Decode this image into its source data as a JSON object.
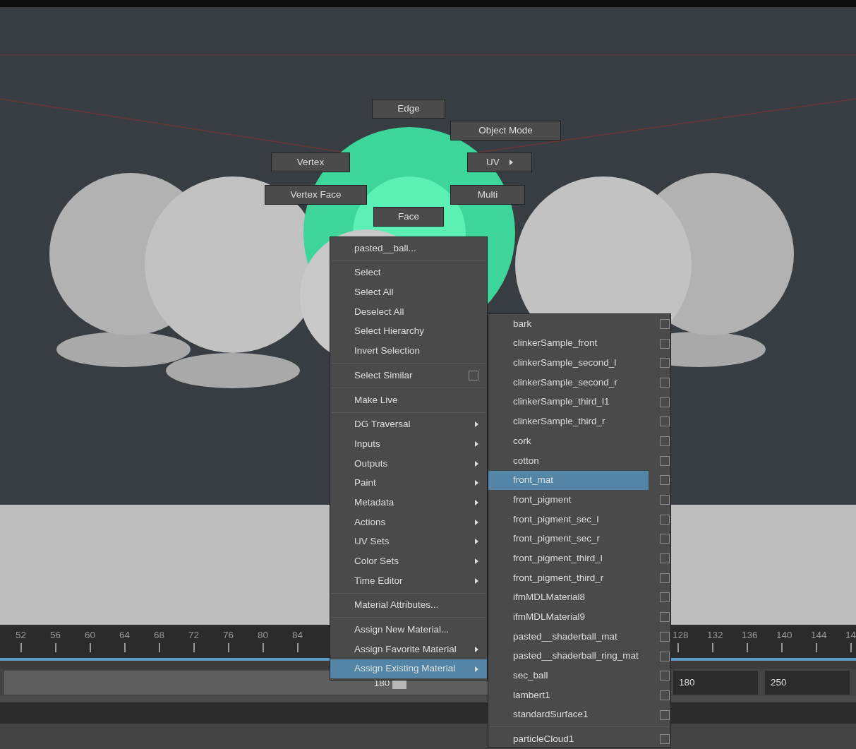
{
  "marking_menu": [
    {
      "label": "Edge",
      "submenu": false
    },
    {
      "label": "Object Mode",
      "submenu": false
    },
    {
      "label": "Vertex",
      "submenu": false
    },
    {
      "label": "UV",
      "submenu": true
    },
    {
      "label": "Vertex Face",
      "submenu": false
    },
    {
      "label": "Multi",
      "submenu": false
    },
    {
      "label": "Face",
      "submenu": false
    }
  ],
  "context_menu": {
    "title": "pasted__ball...",
    "groups": [
      {
        "items": [
          {
            "label": "Select",
            "submenu": false,
            "option_box": false,
            "selected": false
          },
          {
            "label": "Select All",
            "submenu": false,
            "option_box": false,
            "selected": false
          },
          {
            "label": "Deselect All",
            "submenu": false,
            "option_box": false,
            "selected": false
          },
          {
            "label": "Select Hierarchy",
            "submenu": false,
            "option_box": false,
            "selected": false
          },
          {
            "label": "Invert Selection",
            "submenu": false,
            "option_box": false,
            "selected": false
          }
        ]
      },
      {
        "items": [
          {
            "label": "Select Similar",
            "submenu": false,
            "option_box": true,
            "selected": false
          }
        ]
      },
      {
        "items": [
          {
            "label": "Make Live",
            "submenu": false,
            "option_box": false,
            "selected": false
          }
        ]
      },
      {
        "items": [
          {
            "label": "DG Traversal",
            "submenu": true,
            "option_box": false,
            "selected": false
          },
          {
            "label": "Inputs",
            "submenu": true,
            "option_box": false,
            "selected": false
          },
          {
            "label": "Outputs",
            "submenu": true,
            "option_box": false,
            "selected": false
          },
          {
            "label": "Paint",
            "submenu": true,
            "option_box": false,
            "selected": false
          },
          {
            "label": "Metadata",
            "submenu": true,
            "option_box": false,
            "selected": false
          },
          {
            "label": "Actions",
            "submenu": true,
            "option_box": false,
            "selected": false
          },
          {
            "label": "UV Sets",
            "submenu": true,
            "option_box": false,
            "selected": false
          },
          {
            "label": "Color Sets",
            "submenu": true,
            "option_box": false,
            "selected": false
          },
          {
            "label": "Time Editor",
            "submenu": true,
            "option_box": false,
            "selected": false
          }
        ]
      },
      {
        "items": [
          {
            "label": "Material Attributes...",
            "submenu": false,
            "option_box": false,
            "selected": false
          }
        ]
      },
      {
        "items": [
          {
            "label": "Assign New Material...",
            "submenu": false,
            "option_box": false,
            "selected": false
          },
          {
            "label": "Assign Favorite Material",
            "submenu": true,
            "option_box": false,
            "selected": false
          },
          {
            "label": "Assign Existing Material",
            "submenu": true,
            "option_box": false,
            "selected": true
          }
        ]
      }
    ]
  },
  "material_submenu": {
    "groups": [
      {
        "items": [
          {
            "label": "bark",
            "selected": false
          },
          {
            "label": "clinkerSample_front",
            "selected": false
          },
          {
            "label": "clinkerSample_second_l",
            "selected": false
          },
          {
            "label": "clinkerSample_second_r",
            "selected": false
          },
          {
            "label": "clinkerSample_third_l1",
            "selected": false
          },
          {
            "label": "clinkerSample_third_r",
            "selected": false
          },
          {
            "label": "cork",
            "selected": false
          },
          {
            "label": "cotton",
            "selected": false
          },
          {
            "label": "front_mat",
            "selected": true
          },
          {
            "label": "front_pigment",
            "selected": false
          },
          {
            "label": "front_pigment_sec_l",
            "selected": false
          },
          {
            "label": "front_pigment_sec_r",
            "selected": false
          },
          {
            "label": "front_pigment_third_l",
            "selected": false
          },
          {
            "label": "front_pigment_third_r",
            "selected": false
          },
          {
            "label": "ifmMDLMaterial8",
            "selected": false
          },
          {
            "label": "ifmMDLMaterial9",
            "selected": false
          },
          {
            "label": "pasted__shaderball_mat",
            "selected": false
          },
          {
            "label": "pasted__shaderball_ring_mat",
            "selected": false
          },
          {
            "label": "sec_ball",
            "selected": false
          },
          {
            "label": "lambert1",
            "selected": false
          },
          {
            "label": "standardSurface1",
            "selected": false
          }
        ]
      },
      {
        "items": [
          {
            "label": "particleCloud1",
            "selected": false
          }
        ]
      }
    ]
  },
  "timeline": {
    "left_ticks": [
      "52",
      "56",
      "60",
      "64",
      "68",
      "72",
      "76",
      "80",
      "84"
    ],
    "right_ticks": [
      "128",
      "132",
      "136",
      "140",
      "144",
      "14"
    ]
  },
  "range_slider": {
    "current": "180",
    "level": 0.61,
    "fields": [
      "180",
      "250"
    ]
  }
}
